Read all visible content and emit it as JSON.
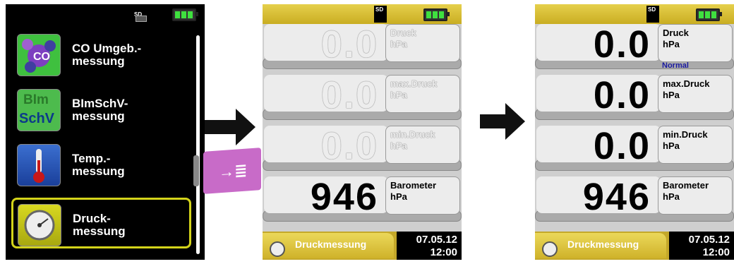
{
  "menu": {
    "sd_label": "SD",
    "items": [
      {
        "label": "CO Umgeb.-\nmessung",
        "icon": "co-molecule-icon"
      },
      {
        "label": "BImSchV-\nmessung",
        "icon": "bimschv-icon",
        "icon_text_top": "BIm",
        "icon_text_bottom": "SchV"
      },
      {
        "label": "Temp.-\nmessung",
        "icon": "thermometer-icon"
      },
      {
        "label": "Druck-\nmessung",
        "icon": "pressure-gauge-icon",
        "selected": true
      }
    ]
  },
  "confirm_button": {
    "icon": "enter-arrow-icon",
    "symbol": "→≣"
  },
  "screen_a": {
    "sd_label": "SD",
    "rows": [
      {
        "value": "0.0",
        "label": "Druck",
        "unit": "hPa",
        "greyed": true
      },
      {
        "value": "0.0",
        "label": "max.Druck",
        "unit": "hPa",
        "greyed": true
      },
      {
        "value": "0.0",
        "label": "min.Druck",
        "unit": "hPa",
        "greyed": true
      },
      {
        "value": "946",
        "label": "Barometer",
        "unit": "hPa",
        "greyed": false
      }
    ],
    "footer": {
      "title": "Druckmessung",
      "date": "07.05.12",
      "time": "12:00"
    }
  },
  "screen_b": {
    "sd_label": "SD",
    "rows": [
      {
        "value": "0.0",
        "label": "Druck",
        "unit": "hPa",
        "status": "Normal"
      },
      {
        "value": "0.0",
        "label": "max.Druck",
        "unit": "hPa"
      },
      {
        "value": "0.0",
        "label": "min.Druck",
        "unit": "hPa"
      },
      {
        "value": "946",
        "label": "Barometer",
        "unit": "hPa"
      }
    ],
    "footer": {
      "title": "Druckmessung",
      "date": "07.05.12",
      "time": "12:00"
    }
  },
  "colors": {
    "accent_yellow": "#d4c02e",
    "status_blue": "#1a1aa0",
    "battery_green": "#3fe03f",
    "button_pink": "#c86bc8"
  }
}
